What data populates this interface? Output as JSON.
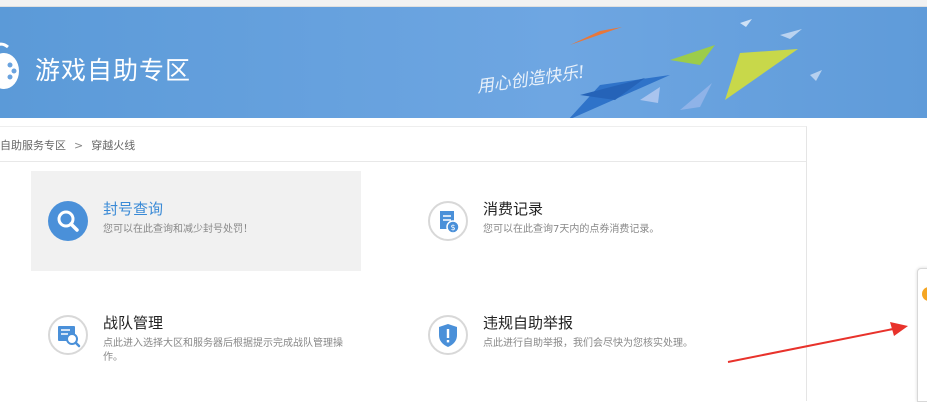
{
  "banner": {
    "title": "游戏自助专区",
    "slogan": "用心创造快乐!",
    "background_color": "#6aa3df",
    "icon": "gamepad-icon"
  },
  "breadcrumb": {
    "home": "自助服务专区",
    "separator": ">",
    "current": "穿越火线"
  },
  "cards": [
    {
      "title": "封号查询",
      "description": "您可以在此查询和减少封号处罚！",
      "icon": "search-icon",
      "active": true
    },
    {
      "title": "消费记录",
      "description": "您可以在此查询7天内的点券消费记录。",
      "icon": "bill-icon"
    },
    {
      "title": "战队管理",
      "description": "点此进入选择大区和服务器后根据提示完成战队管理操作。",
      "icon": "team-search-icon"
    },
    {
      "title": "违规自助举报",
      "description": "点此进行自助举报，我们会尽快为您核实处理。",
      "icon": "shield-icon"
    }
  ],
  "colors": {
    "accent": "#4a90d9",
    "annotation_arrow": "#e8322b"
  }
}
